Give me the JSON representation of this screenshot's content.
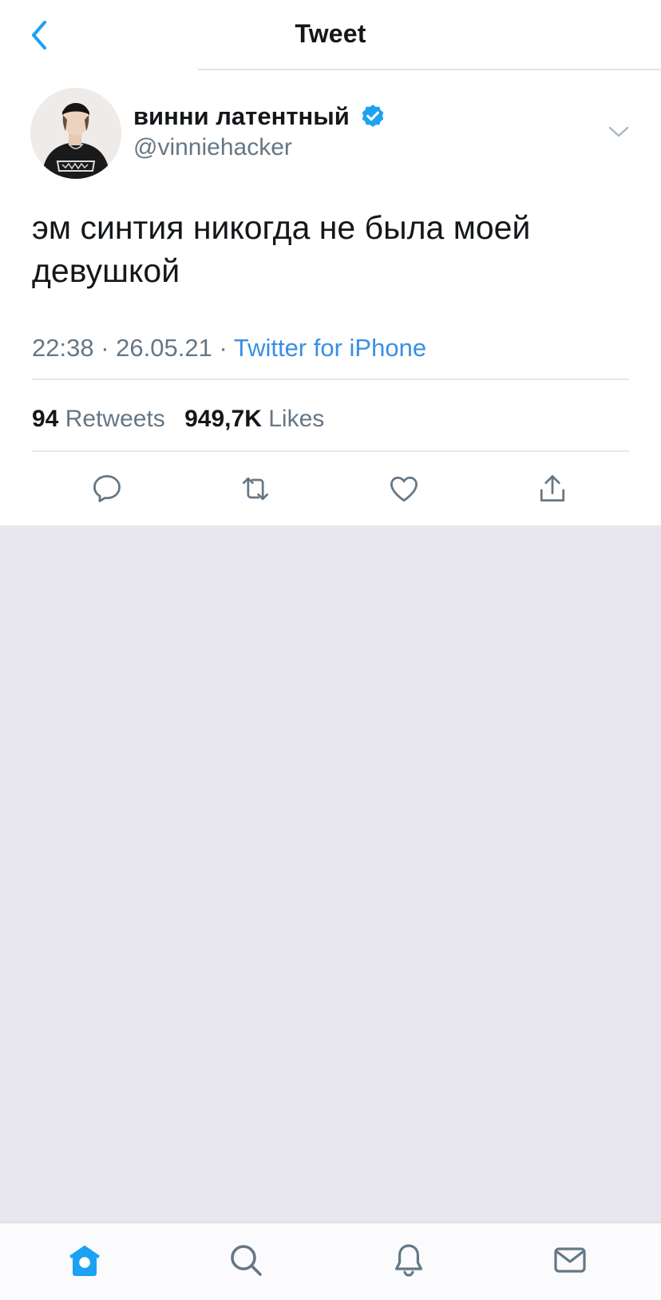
{
  "nav": {
    "title": "Tweet"
  },
  "tweet": {
    "author_name": "винни латентный",
    "author_handle": "@vinniehacker",
    "text": "эм синтия никогда не была моей девушкой",
    "time": "22:38",
    "date": "26.05.21",
    "source": "Twitter for iPhone",
    "separator": "·"
  },
  "stats": {
    "retweets_count": "94",
    "retweets_label": "Retweets",
    "likes_count": "949,7K",
    "likes_label": "Likes"
  },
  "icons": {
    "back": "chevron-left-icon",
    "verified": "verified-badge-icon",
    "more": "chevron-down-icon",
    "reply": "reply-icon",
    "retweet": "retweet-icon",
    "like": "heart-icon",
    "share": "share-icon",
    "home": "home-icon",
    "search": "search-icon",
    "notifications": "bell-icon",
    "messages": "mail-icon"
  },
  "colors": {
    "accent": "#1da1f2",
    "link": "#3a8fe4",
    "text": "#14171a",
    "secondary": "#657786",
    "empty_bg": "#e8e7f0"
  }
}
